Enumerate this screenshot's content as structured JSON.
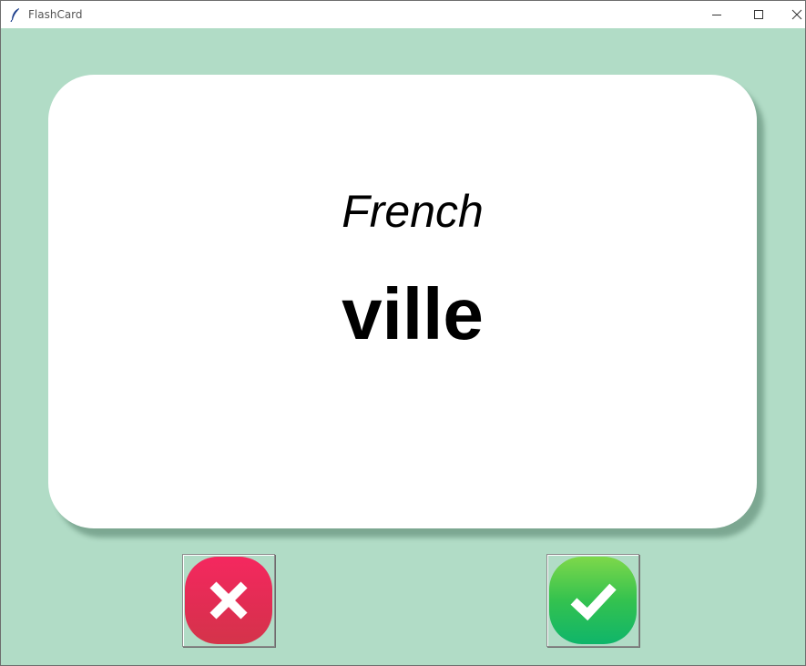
{
  "window": {
    "title": "FlashCard"
  },
  "card": {
    "title": "French",
    "word": "ville"
  },
  "buttons": {
    "wrong_icon": "cross-icon",
    "right_icon": "check-icon"
  },
  "colors": {
    "background": "#b1dcc6",
    "card": "#ffffff",
    "wrong": "#e83057",
    "right": "#2ebf55"
  }
}
